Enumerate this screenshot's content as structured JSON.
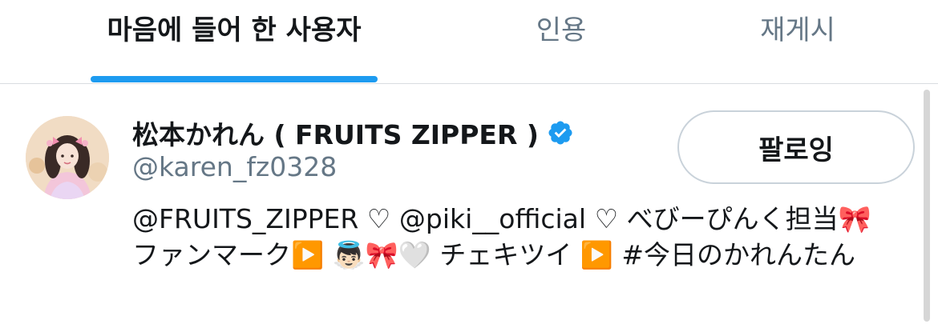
{
  "tabs": {
    "likes": "마음에 들어 한 사용자",
    "quotes": "인용",
    "reposts": "재게시"
  },
  "user": {
    "display_name": "松本かれん ( FRUITS ZIPPER )",
    "verified": true,
    "handle": "@karen_fz0328",
    "follow_label": "팔로잉",
    "bio": "@FRUITS_ZIPPER ♡ @piki__official ♡ べびーぴんく担当🎀 ファンマーク▶️ 👼🏻🎀🤍 チェキツイ ▶️ #今日のかれんたん"
  },
  "colors": {
    "accent": "#1d9bf0",
    "secondary_text": "#657786",
    "primary_text": "#14171a"
  },
  "icons": {
    "verified": "verified-badge-icon"
  }
}
